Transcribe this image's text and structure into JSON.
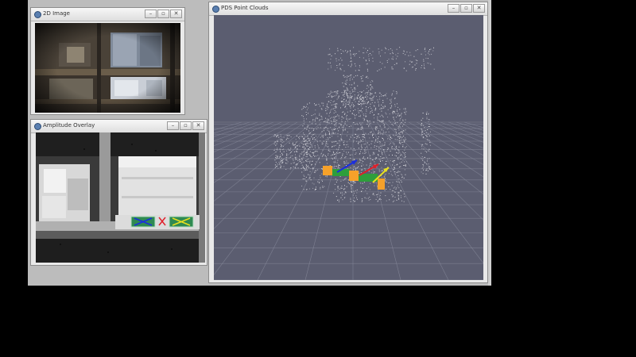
{
  "windows": {
    "image2d": {
      "title": "2D Image"
    },
    "overlay": {
      "title": "Amplitude Overlay"
    },
    "pointcloud": {
      "title": "PDS Point Clouds"
    }
  },
  "window_controls": {
    "minimize": "–",
    "restore": "▫",
    "close": "✕"
  },
  "colors": {
    "desktop": "#bcbcbc",
    "viewport_bg": "#5b5d70",
    "grid": "#8c8ea0",
    "pallet_orange": "#f6a12a",
    "pallet_green": "#2e9e3c",
    "axis_blue": "#1a2de0",
    "axis_red": "#e0202a",
    "axis_yellow": "#e8e020"
  },
  "overlay_markers": {
    "left": {
      "icon": "pallet-pocket-marker-blue"
    },
    "right": {
      "icon": "pallet-pocket-marker-yellow"
    },
    "center": {
      "icon": "cross-icon"
    }
  }
}
